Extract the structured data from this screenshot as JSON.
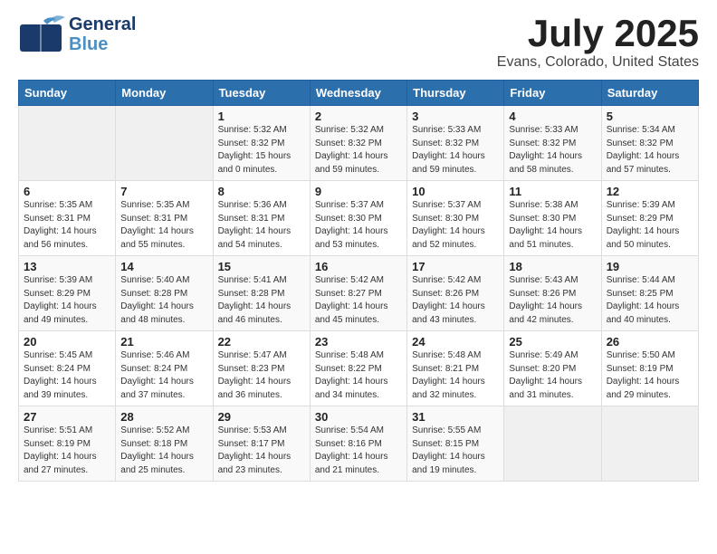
{
  "header": {
    "logo_line1": "General",
    "logo_line2": "Blue",
    "title": "July 2025",
    "subtitle": "Evans, Colorado, United States"
  },
  "weekdays": [
    "Sunday",
    "Monday",
    "Tuesday",
    "Wednesday",
    "Thursday",
    "Friday",
    "Saturday"
  ],
  "weeks": [
    [
      {
        "day": "",
        "info": ""
      },
      {
        "day": "",
        "info": ""
      },
      {
        "day": "1",
        "info": "Sunrise: 5:32 AM\nSunset: 8:32 PM\nDaylight: 15 hours\nand 0 minutes."
      },
      {
        "day": "2",
        "info": "Sunrise: 5:32 AM\nSunset: 8:32 PM\nDaylight: 14 hours\nand 59 minutes."
      },
      {
        "day": "3",
        "info": "Sunrise: 5:33 AM\nSunset: 8:32 PM\nDaylight: 14 hours\nand 59 minutes."
      },
      {
        "day": "4",
        "info": "Sunrise: 5:33 AM\nSunset: 8:32 PM\nDaylight: 14 hours\nand 58 minutes."
      },
      {
        "day": "5",
        "info": "Sunrise: 5:34 AM\nSunset: 8:32 PM\nDaylight: 14 hours\nand 57 minutes."
      }
    ],
    [
      {
        "day": "6",
        "info": "Sunrise: 5:35 AM\nSunset: 8:31 PM\nDaylight: 14 hours\nand 56 minutes."
      },
      {
        "day": "7",
        "info": "Sunrise: 5:35 AM\nSunset: 8:31 PM\nDaylight: 14 hours\nand 55 minutes."
      },
      {
        "day": "8",
        "info": "Sunrise: 5:36 AM\nSunset: 8:31 PM\nDaylight: 14 hours\nand 54 minutes."
      },
      {
        "day": "9",
        "info": "Sunrise: 5:37 AM\nSunset: 8:30 PM\nDaylight: 14 hours\nand 53 minutes."
      },
      {
        "day": "10",
        "info": "Sunrise: 5:37 AM\nSunset: 8:30 PM\nDaylight: 14 hours\nand 52 minutes."
      },
      {
        "day": "11",
        "info": "Sunrise: 5:38 AM\nSunset: 8:30 PM\nDaylight: 14 hours\nand 51 minutes."
      },
      {
        "day": "12",
        "info": "Sunrise: 5:39 AM\nSunset: 8:29 PM\nDaylight: 14 hours\nand 50 minutes."
      }
    ],
    [
      {
        "day": "13",
        "info": "Sunrise: 5:39 AM\nSunset: 8:29 PM\nDaylight: 14 hours\nand 49 minutes."
      },
      {
        "day": "14",
        "info": "Sunrise: 5:40 AM\nSunset: 8:28 PM\nDaylight: 14 hours\nand 48 minutes."
      },
      {
        "day": "15",
        "info": "Sunrise: 5:41 AM\nSunset: 8:28 PM\nDaylight: 14 hours\nand 46 minutes."
      },
      {
        "day": "16",
        "info": "Sunrise: 5:42 AM\nSunset: 8:27 PM\nDaylight: 14 hours\nand 45 minutes."
      },
      {
        "day": "17",
        "info": "Sunrise: 5:42 AM\nSunset: 8:26 PM\nDaylight: 14 hours\nand 43 minutes."
      },
      {
        "day": "18",
        "info": "Sunrise: 5:43 AM\nSunset: 8:26 PM\nDaylight: 14 hours\nand 42 minutes."
      },
      {
        "day": "19",
        "info": "Sunrise: 5:44 AM\nSunset: 8:25 PM\nDaylight: 14 hours\nand 40 minutes."
      }
    ],
    [
      {
        "day": "20",
        "info": "Sunrise: 5:45 AM\nSunset: 8:24 PM\nDaylight: 14 hours\nand 39 minutes."
      },
      {
        "day": "21",
        "info": "Sunrise: 5:46 AM\nSunset: 8:24 PM\nDaylight: 14 hours\nand 37 minutes."
      },
      {
        "day": "22",
        "info": "Sunrise: 5:47 AM\nSunset: 8:23 PM\nDaylight: 14 hours\nand 36 minutes."
      },
      {
        "day": "23",
        "info": "Sunrise: 5:48 AM\nSunset: 8:22 PM\nDaylight: 14 hours\nand 34 minutes."
      },
      {
        "day": "24",
        "info": "Sunrise: 5:48 AM\nSunset: 8:21 PM\nDaylight: 14 hours\nand 32 minutes."
      },
      {
        "day": "25",
        "info": "Sunrise: 5:49 AM\nSunset: 8:20 PM\nDaylight: 14 hours\nand 31 minutes."
      },
      {
        "day": "26",
        "info": "Sunrise: 5:50 AM\nSunset: 8:19 PM\nDaylight: 14 hours\nand 29 minutes."
      }
    ],
    [
      {
        "day": "27",
        "info": "Sunrise: 5:51 AM\nSunset: 8:19 PM\nDaylight: 14 hours\nand 27 minutes."
      },
      {
        "day": "28",
        "info": "Sunrise: 5:52 AM\nSunset: 8:18 PM\nDaylight: 14 hours\nand 25 minutes."
      },
      {
        "day": "29",
        "info": "Sunrise: 5:53 AM\nSunset: 8:17 PM\nDaylight: 14 hours\nand 23 minutes."
      },
      {
        "day": "30",
        "info": "Sunrise: 5:54 AM\nSunset: 8:16 PM\nDaylight: 14 hours\nand 21 minutes."
      },
      {
        "day": "31",
        "info": "Sunrise: 5:55 AM\nSunset: 8:15 PM\nDaylight: 14 hours\nand 19 minutes."
      },
      {
        "day": "",
        "info": ""
      },
      {
        "day": "",
        "info": ""
      }
    ]
  ]
}
